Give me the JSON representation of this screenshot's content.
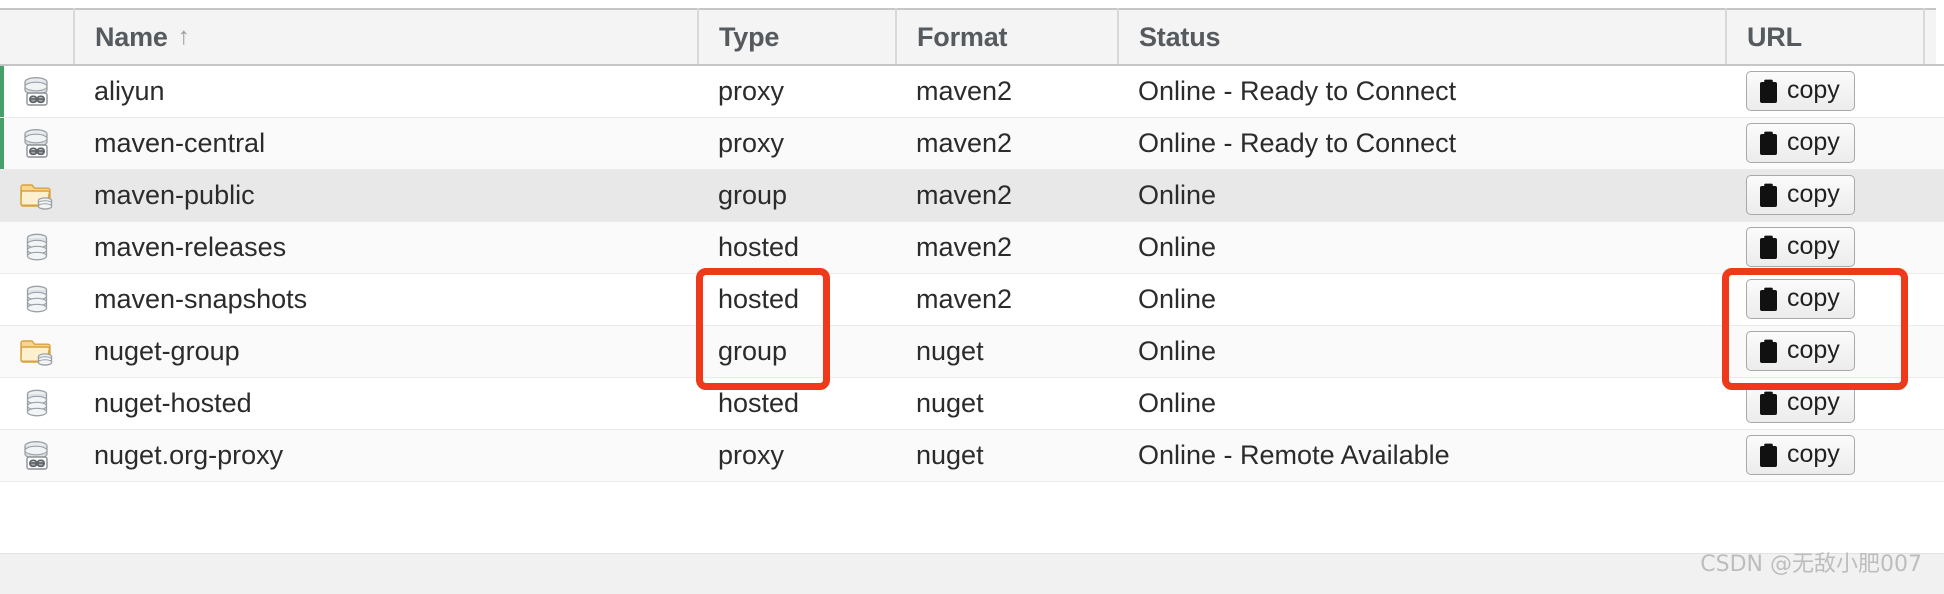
{
  "table": {
    "columns": [
      {
        "key": "icon",
        "label": ""
      },
      {
        "key": "name",
        "label": "Name",
        "sort": "↑"
      },
      {
        "key": "type",
        "label": "Type"
      },
      {
        "key": "format",
        "label": "Format"
      },
      {
        "key": "status",
        "label": "Status"
      },
      {
        "key": "url",
        "label": "URL"
      }
    ],
    "rows": [
      {
        "icon": "proxy-repository-icon",
        "name": "aliyun",
        "type": "proxy",
        "format": "maven2",
        "status": "Online - Ready to Connect",
        "url_button": "copy"
      },
      {
        "icon": "proxy-repository-icon",
        "name": "maven-central",
        "type": "proxy",
        "format": "maven2",
        "status": "Online - Ready to Connect",
        "url_button": "copy"
      },
      {
        "icon": "group-repository-icon",
        "name": "maven-public",
        "type": "group",
        "format": "maven2",
        "status": "Online",
        "url_button": "copy"
      },
      {
        "icon": "hosted-repository-icon",
        "name": "maven-releases",
        "type": "hosted",
        "format": "maven2",
        "status": "Online",
        "url_button": "copy"
      },
      {
        "icon": "hosted-repository-icon",
        "name": "maven-snapshots",
        "type": "hosted",
        "format": "maven2",
        "status": "Online",
        "url_button": "copy"
      },
      {
        "icon": "group-repository-icon",
        "name": "nuget-group",
        "type": "group",
        "format": "nuget",
        "status": "Online",
        "url_button": "copy"
      },
      {
        "icon": "hosted-repository-icon",
        "name": "nuget-hosted",
        "type": "hosted",
        "format": "nuget",
        "status": "Online",
        "url_button": "copy"
      },
      {
        "icon": "proxy-repository-icon",
        "name": "nuget.org-proxy",
        "type": "proxy",
        "format": "nuget",
        "status": "Online - Remote Available",
        "url_button": "copy"
      }
    ]
  },
  "annotations": {
    "color": "#ee3a1a",
    "type_box_label": "hosted-type-highlight",
    "url_box_label": "copy-button-highlight"
  },
  "watermark": "CSDN @无敌小肥007"
}
